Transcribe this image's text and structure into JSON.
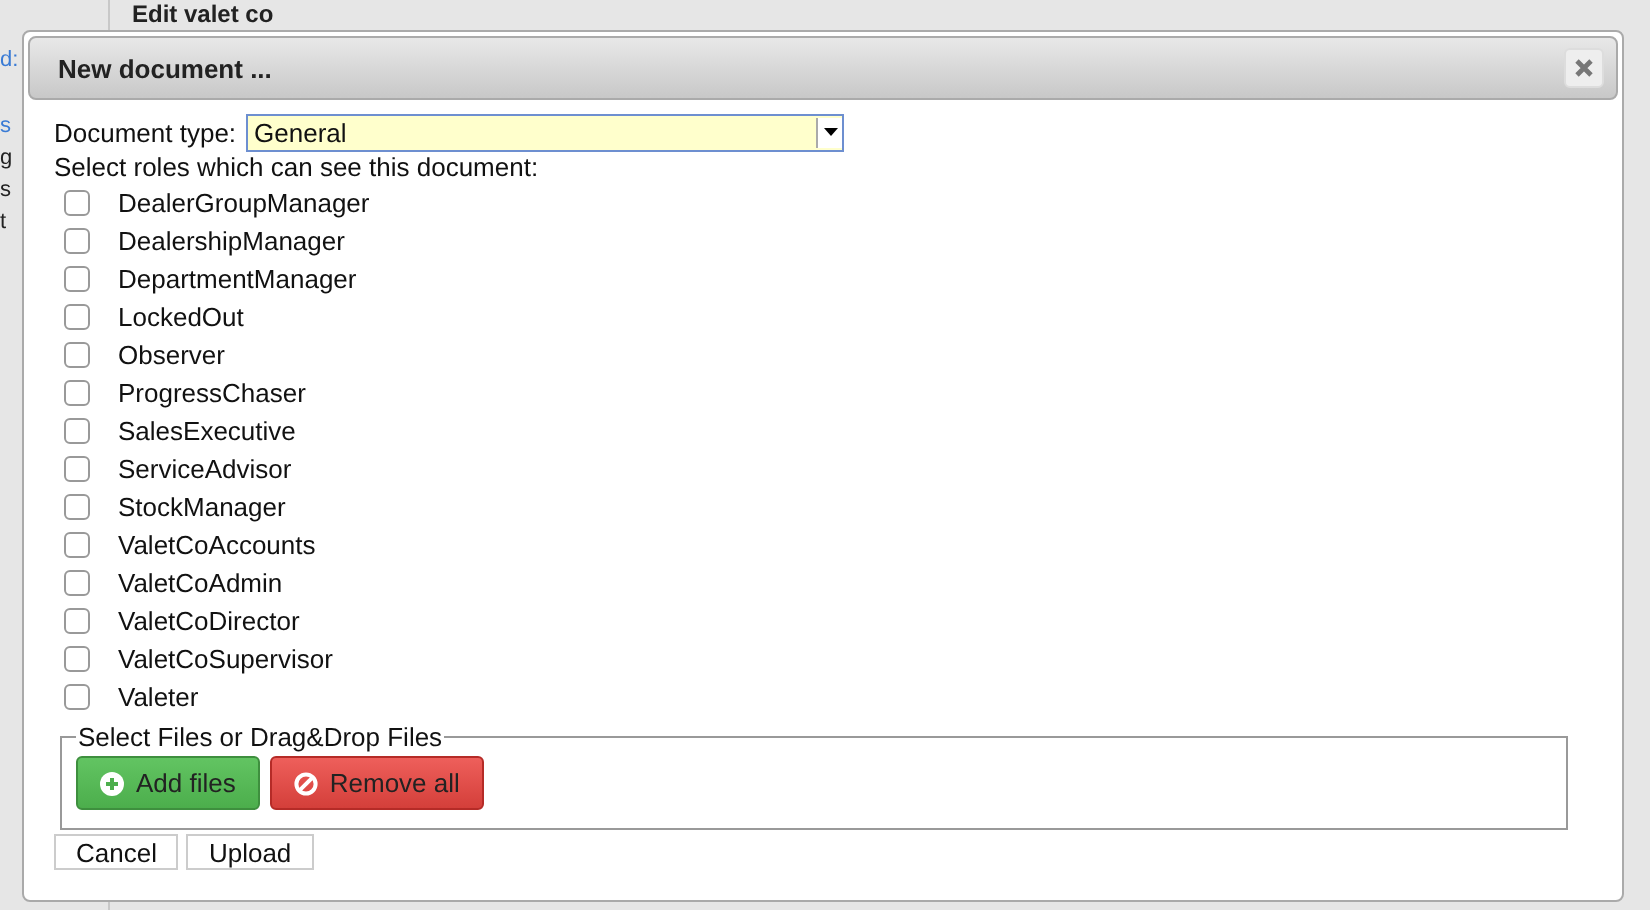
{
  "background": {
    "heading": "Edit valet co",
    "side_fragments": [
      {
        "text": "d:",
        "link": true
      },
      {
        "text": "s",
        "link": true
      },
      {
        "text": "g",
        "link": false
      },
      {
        "text": "s",
        "link": false
      },
      {
        "text": "t",
        "link": false
      }
    ]
  },
  "dialog": {
    "title": "New document ...",
    "document_type": {
      "label": "Document type:",
      "value": "General"
    },
    "roles_label": "Select roles which can see this document:",
    "roles": [
      {
        "name": "DealerGroupManager",
        "checked": false
      },
      {
        "name": "DealershipManager",
        "checked": false
      },
      {
        "name": "DepartmentManager",
        "checked": false
      },
      {
        "name": "LockedOut",
        "checked": false
      },
      {
        "name": "Observer",
        "checked": false
      },
      {
        "name": "ProgressChaser",
        "checked": false
      },
      {
        "name": "SalesExecutive",
        "checked": false
      },
      {
        "name": "ServiceAdvisor",
        "checked": false
      },
      {
        "name": "StockManager",
        "checked": false
      },
      {
        "name": "ValetCoAccounts",
        "checked": false
      },
      {
        "name": "ValetCoAdmin",
        "checked": false
      },
      {
        "name": "ValetCoDirector",
        "checked": false
      },
      {
        "name": "ValetCoSupervisor",
        "checked": false
      },
      {
        "name": "Valeter",
        "checked": false
      }
    ],
    "files": {
      "legend": "Select Files or Drag&Drop Files",
      "buttons": [
        {
          "label": "Add files",
          "kind": "add"
        },
        {
          "label": "Remove all",
          "kind": "remove"
        }
      ]
    },
    "buttons": [
      "Cancel",
      "Upload"
    ]
  }
}
